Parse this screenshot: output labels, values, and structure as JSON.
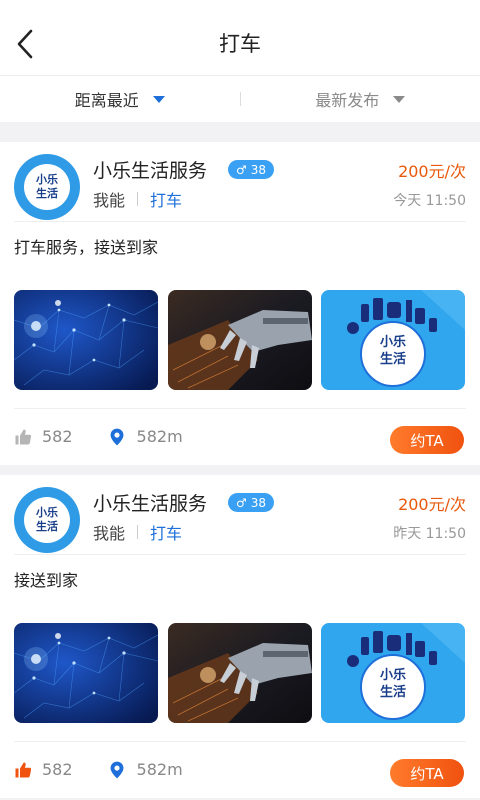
{
  "header": {
    "title": "打车",
    "back_icon": "chevron-left-icon"
  },
  "filters": [
    {
      "label": "距离最近",
      "active": true
    },
    {
      "label": "最新发布",
      "active": false
    }
  ],
  "colors": {
    "accent": "#1e6fd9",
    "price": "#e8580c",
    "button": "#f0520f",
    "badge": "#3aa0f3"
  },
  "posts": [
    {
      "avatar_text_line1": "小乐",
      "avatar_text_line2": "生活",
      "name": "小乐生活服务",
      "gender_symbol": "♂",
      "age": "38",
      "price": "200元/次",
      "role": "我能",
      "tag": "打车",
      "time": "今天  11:50",
      "description": "打车服务，接送到家",
      "photos": [
        {
          "image": "blue-network-tech",
          "caption": ""
        },
        {
          "image": "robot-hand-chip",
          "caption": ""
        },
        {
          "image": "cleaning-logo",
          "caption_line1": "小乐",
          "caption_line2": "生活"
        }
      ],
      "likes": "582",
      "like_icon_color": "#b5b5b5",
      "distance": "582m",
      "book_label": "约TA"
    },
    {
      "avatar_text_line1": "小乐",
      "avatar_text_line2": "生活",
      "name": "小乐生活服务",
      "gender_symbol": "♂",
      "age": "38",
      "price": "200元/次",
      "role": "我能",
      "tag": "打车",
      "time": "昨天  11:50",
      "description": "接送到家",
      "photos": [
        {
          "image": "blue-network-tech",
          "caption": ""
        },
        {
          "image": "robot-hand-chip",
          "caption": ""
        },
        {
          "image": "cleaning-logo",
          "caption_line1": "小乐",
          "caption_line2": "生活"
        }
      ],
      "likes": "582",
      "like_icon_color": "#f0520f",
      "distance": "582m",
      "book_label": "约TA"
    }
  ]
}
